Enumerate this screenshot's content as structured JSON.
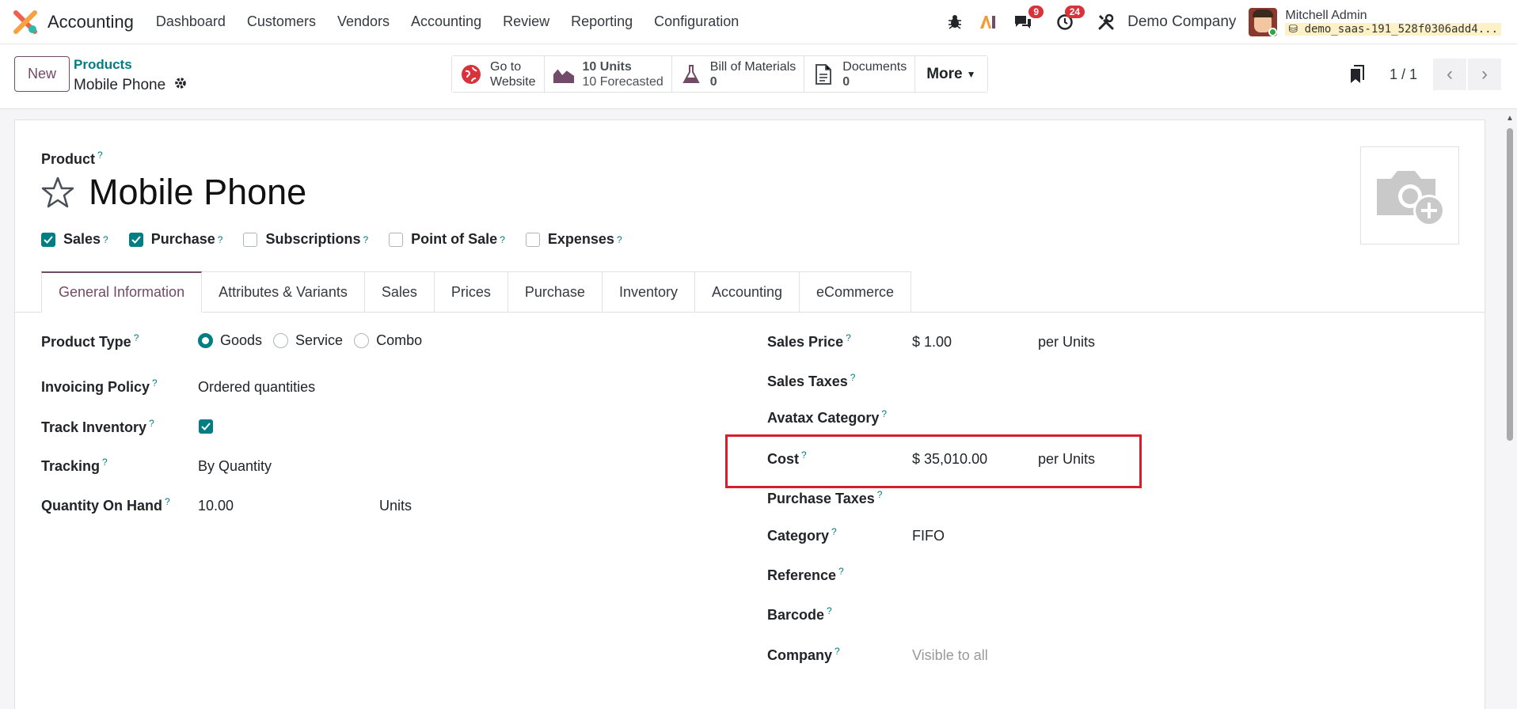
{
  "navbar": {
    "app_name": "Accounting",
    "menu": [
      "Dashboard",
      "Customers",
      "Vendors",
      "Accounting",
      "Review",
      "Reporting",
      "Configuration"
    ],
    "messages_badge": "9",
    "activities_badge": "24",
    "company": "Demo Company",
    "user_name": "Mitchell Admin",
    "database": "demo_saas-191_528f0306add4..."
  },
  "control_panel": {
    "new_label": "New",
    "breadcrumb_parent": "Products",
    "record_name": "Mobile Phone",
    "smart_buttons": {
      "website_line1": "Go to",
      "website_line2": "Website",
      "units_value": "10 Units",
      "units_forecast": "10 Forecasted",
      "bom_label": "Bill of Materials",
      "bom_count": "0",
      "documents_label": "Documents",
      "documents_count": "0",
      "more_label": "More"
    },
    "pager_value": "1 / 1"
  },
  "form": {
    "product_label": "Product",
    "product_name": "Mobile Phone",
    "checkboxes": [
      {
        "label": "Sales",
        "checked": true
      },
      {
        "label": "Purchase",
        "checked": true
      },
      {
        "label": "Subscriptions",
        "checked": false
      },
      {
        "label": "Point of Sale",
        "checked": false
      },
      {
        "label": "Expenses",
        "checked": false
      }
    ],
    "tabs": [
      "General Information",
      "Attributes & Variants",
      "Sales",
      "Prices",
      "Purchase",
      "Inventory",
      "Accounting",
      "eCommerce"
    ],
    "active_tab": "General Information",
    "left": {
      "product_type_label": "Product Type",
      "product_type_options": [
        "Goods",
        "Service",
        "Combo"
      ],
      "product_type_selected": "Goods",
      "invoicing_policy_label": "Invoicing Policy",
      "invoicing_policy_value": "Ordered quantities",
      "track_inventory_label": "Track Inventory",
      "track_inventory_checked": true,
      "tracking_label": "Tracking",
      "tracking_value": "By Quantity",
      "qty_label": "Quantity On Hand",
      "qty_value": "10.00",
      "qty_uom": "Units"
    },
    "right": {
      "sales_price_label": "Sales Price",
      "sales_price_value": "$ 1.00",
      "sales_price_uom": "per Units",
      "sales_taxes_label": "Sales Taxes",
      "avatax_label": "Avatax Category",
      "cost_label": "Cost",
      "cost_value": "$ 35,010.00",
      "cost_uom": "per Units",
      "purchase_taxes_label": "Purchase Taxes",
      "category_label": "Category",
      "category_value": "FIFO",
      "reference_label": "Reference",
      "barcode_label": "Barcode",
      "company_label": "Company",
      "company_placeholder": "Visible to all"
    },
    "help_mark": "?"
  },
  "colors": {
    "primary": "#714b67",
    "accent": "#017e84",
    "highlight": "#d61f2c"
  }
}
